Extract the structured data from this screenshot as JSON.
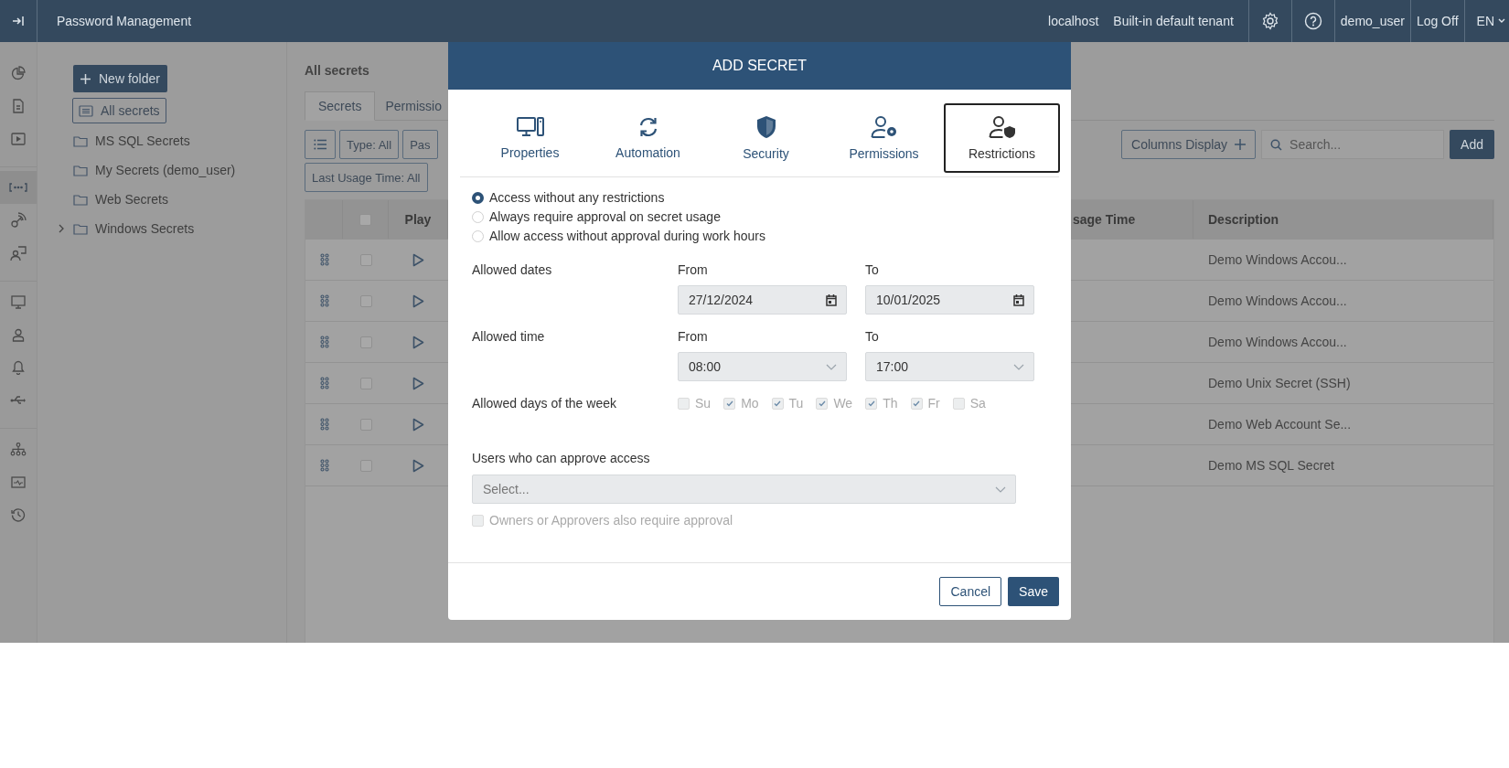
{
  "topbar": {
    "title": "Password Management",
    "host": "localhost",
    "tenant": "Built-in default tenant",
    "user": "demo_user",
    "logoff": "Log Off",
    "language": "EN"
  },
  "rail": [
    [
      {
        "selected": false
      },
      {
        "selected": false
      },
      {
        "selected": false
      }
    ],
    [
      {
        "selected": true
      },
      {
        "selected": false
      },
      {
        "selected": false
      }
    ],
    [
      {
        "selected": false
      },
      {
        "selected": false
      },
      {
        "selected": false
      },
      {
        "selected": false
      }
    ],
    [
      {
        "selected": false
      },
      {
        "selected": false
      },
      {
        "selected": false
      }
    ]
  ],
  "folders": {
    "new_folder": "New folder",
    "items": [
      {
        "kind": "all",
        "label": "All secrets",
        "selected": true,
        "expandable": false
      },
      {
        "kind": "folder",
        "label": "MS SQL Secrets",
        "selected": false,
        "expandable": false
      },
      {
        "kind": "folder",
        "label": "My Secrets (demo_user)",
        "selected": false,
        "expandable": false
      },
      {
        "kind": "folder",
        "label": "Web Secrets",
        "selected": false,
        "expandable": false
      },
      {
        "kind": "folder",
        "label": "Windows Secrets",
        "selected": false,
        "expandable": true
      }
    ]
  },
  "main": {
    "heading": "All secrets",
    "tabs": [
      {
        "label": "Secrets",
        "selected": true
      },
      {
        "label": "Permissio",
        "selected": false
      }
    ],
    "filters": [
      "Type: All",
      "Pas",
      "Last Usage Time: All"
    ],
    "columns_button": "Columns Display",
    "search": {
      "placeholder": "Search..."
    },
    "add_button": "Add",
    "table": {
      "header_checked": false,
      "columns": [
        "Play",
        "sage Time",
        "Description"
      ],
      "rows": [
        {
          "checked": false,
          "description": "Demo Windows Accou..."
        },
        {
          "checked": false,
          "description": "Demo Windows Accou..."
        },
        {
          "checked": false,
          "description": "Demo Windows Accou..."
        },
        {
          "checked": false,
          "description": "Demo Unix Secret (SSH)"
        },
        {
          "checked": false,
          "description": "Demo Web Account Se..."
        },
        {
          "checked": false,
          "description": "Demo MS SQL Secret"
        }
      ]
    }
  },
  "modal": {
    "title": "ADD SECRET",
    "tabs": [
      {
        "label": "Properties",
        "selected": false
      },
      {
        "label": "Automation",
        "selected": false
      },
      {
        "label": "Security",
        "selected": false
      },
      {
        "label": "Permissions",
        "selected": false
      },
      {
        "label": "Restrictions",
        "selected": true
      }
    ],
    "access_options": [
      {
        "label": "Access without any restrictions",
        "selected": true
      },
      {
        "label": "Always require approval on secret usage",
        "selected": false
      },
      {
        "label": "Allow access without approval during work hours",
        "selected": false
      }
    ],
    "dates": {
      "label": "Allowed dates",
      "from_label": "From",
      "from": "27/12/2024",
      "to_label": "To",
      "to": "10/01/2025"
    },
    "time": {
      "label": "Allowed time",
      "from_label": "From",
      "from": "08:00",
      "to_label": "To",
      "to": "17:00"
    },
    "days": {
      "label": "Allowed days of the week",
      "disabled": true,
      "items": [
        {
          "label": "Su",
          "checked": false
        },
        {
          "label": "Mo",
          "checked": true
        },
        {
          "label": "Tu",
          "checked": true
        },
        {
          "label": "We",
          "checked": true
        },
        {
          "label": "Th",
          "checked": true
        },
        {
          "label": "Fr",
          "checked": true
        },
        {
          "label": "Sa",
          "checked": false
        }
      ]
    },
    "approvers": {
      "label": "Users who can approve access",
      "placeholder": "Select...",
      "disabled": true
    },
    "owners_checkbox": {
      "label": "Owners or Approvers also require approval",
      "checked": false,
      "disabled": true
    },
    "buttons": {
      "cancel": "Cancel",
      "save": "Save"
    }
  }
}
